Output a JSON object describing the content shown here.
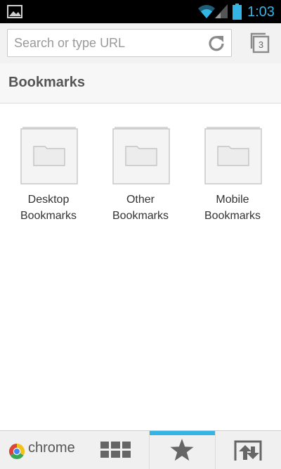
{
  "status_bar": {
    "time": "1:03",
    "icons": [
      "gallery-icon",
      "wifi-icon",
      "signal-icon",
      "battery-icon"
    ],
    "accent_color": "#33b5e5"
  },
  "toolbar": {
    "search": {
      "placeholder": "Search or type URL",
      "value": ""
    },
    "reload_icon": "reload-icon",
    "tab_count": "3"
  },
  "section": {
    "title": "Bookmarks"
  },
  "folders": [
    {
      "line1": "Desktop",
      "line2": "Bookmarks"
    },
    {
      "line1": "Other",
      "line2": "Bookmarks"
    },
    {
      "line1": "Mobile",
      "line2": "Bookmarks"
    }
  ],
  "bottom_bar": {
    "brand": "chrome",
    "items": [
      "most-visited-icon",
      "bookmarks-star-icon",
      "other-devices-icon"
    ],
    "active": "bookmarks"
  }
}
